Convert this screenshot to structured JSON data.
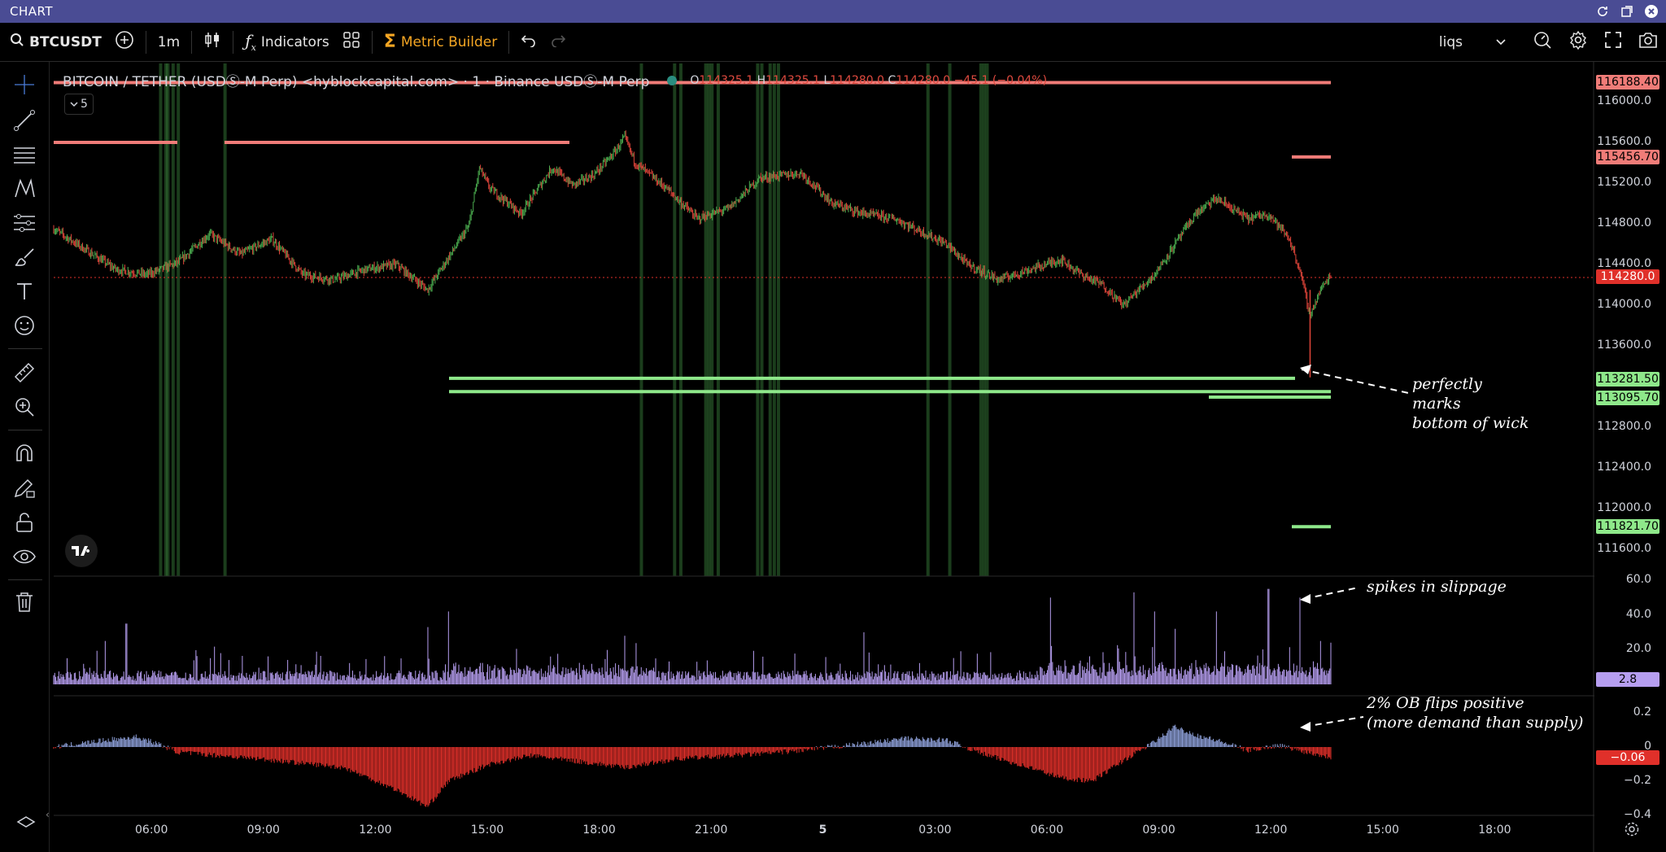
{
  "window": {
    "title": "CHART"
  },
  "toolbar": {
    "symbol": "BTCUSDT",
    "interval": "1m",
    "indicators_label": "Indicators",
    "metric_builder_label": "Metric Builder",
    "layout_select": "liqs"
  },
  "legend": {
    "title": "BITCOIN / TETHER (USDⓈ-M Perp) <hyblockcapital.com> · 1 · Binance USDⓈ-M Perp",
    "o_label": "O",
    "o": "114325.1",
    "h_label": "H",
    "h": "114325.1",
    "l_label": "L",
    "l": "114280.0",
    "c_label": "C",
    "c": "114280.0",
    "change": "−45.1 (−0.04%)",
    "collapsed_count": "5"
  },
  "price_axis": {
    "ticks": [
      "116000.0",
      "115600.0",
      "115200.0",
      "114800.0",
      "114400.0",
      "114000.0",
      "113600.0",
      "112800.0",
      "112400.0",
      "112000.0",
      "111600.0"
    ],
    "labels": [
      {
        "text": "116188.40",
        "bg": "#f07c78",
        "color": "#000"
      },
      {
        "text": "115456.70",
        "bg": "#f07c78",
        "color": "#000"
      },
      {
        "text": "114280.0",
        "bg": "#e0302a",
        "color": "#fff"
      },
      {
        "text": "113281.50",
        "bg": "#8ee88a",
        "color": "#000"
      },
      {
        "text": "113095.70",
        "bg": "#8ee88a",
        "color": "#000"
      },
      {
        "text": "111821.70",
        "bg": "#8ee88a",
        "color": "#000"
      }
    ]
  },
  "slippage_axis": {
    "ticks": [
      "60.0",
      "40.0",
      "20.0"
    ],
    "label": {
      "text": "2.8",
      "bg": "#b69ef0",
      "color": "#000"
    }
  },
  "ob_axis": {
    "ticks": [
      "0.2",
      "0",
      "−0.2",
      "−0.4"
    ],
    "label": {
      "text": "−0.06",
      "bg": "#e0302a",
      "color": "#fff"
    }
  },
  "time_axis": [
    "06:00",
    "09:00",
    "12:00",
    "15:00",
    "18:00",
    "21:00",
    "5",
    "03:00",
    "06:00",
    "09:00",
    "12:00",
    "15:00",
    "18:00"
  ],
  "annotations": {
    "wick": [
      "perfectly",
      "marks",
      "bottom of wick"
    ],
    "slippage": "spikes in slippage",
    "ob": [
      "2% OB flips positive",
      "(more demand than supply)"
    ]
  },
  "colors": {
    "up": "#4caf50",
    "down": "#e0453a",
    "resistance": "#f07c78",
    "support": "#8ee88a",
    "slippage": "#b69ef0",
    "ob_pos": "#8d9fd8",
    "ob_neg": "#e0302a",
    "title_bar": "#4a4c94",
    "accent": "#f5a623"
  },
  "chart_data": [
    {
      "type": "candlestick",
      "title": "BITCOIN / TETHER (USDⓈ-M Perp)",
      "ylim": [
        111400,
        116300
      ],
      "x_ticks": [
        "06:00",
        "09:00",
        "12:00",
        "15:00",
        "18:00",
        "21:00",
        "5",
        "03:00",
        "06:00",
        "09:00",
        "12:00",
        "15:00",
        "18:00"
      ],
      "price_path": [
        [
          0,
          114750
        ],
        [
          3,
          114550
        ],
        [
          6,
          114350
        ],
        [
          9,
          114300
        ],
        [
          12,
          114420
        ],
        [
          15,
          114700
        ],
        [
          18,
          114500
        ],
        [
          21,
          114650
        ],
        [
          24,
          114300
        ],
        [
          27,
          114250
        ],
        [
          30,
          114350
        ],
        [
          33,
          114400
        ],
        [
          36,
          114150
        ],
        [
          40,
          114780
        ],
        [
          41,
          115350
        ],
        [
          42,
          115150
        ],
        [
          45,
          114900
        ],
        [
          48,
          115350
        ],
        [
          50,
          115180
        ],
        [
          52,
          115280
        ],
        [
          54,
          115500
        ],
        [
          55,
          115650
        ],
        [
          56,
          115400
        ],
        [
          59,
          115150
        ],
        [
          62,
          114850
        ],
        [
          65,
          114950
        ],
        [
          68,
          115250
        ],
        [
          72,
          115300
        ],
        [
          75,
          115000
        ],
        [
          78,
          114900
        ],
        [
          81,
          114850
        ],
        [
          84,
          114700
        ],
        [
          86,
          114600
        ],
        [
          88,
          114400
        ],
        [
          91,
          114250
        ],
        [
          94,
          114350
        ],
        [
          97,
          114450
        ],
        [
          99,
          114300
        ],
        [
          101,
          114200
        ],
        [
          103,
          114000
        ],
        [
          104,
          114100
        ],
        [
          106,
          114300
        ],
        [
          108,
          114600
        ],
        [
          110,
          114900
        ],
        [
          112,
          115050
        ],
        [
          115,
          114850
        ],
        [
          117,
          114900
        ],
        [
          119,
          114650
        ],
        [
          120,
          114350
        ],
        [
          121,
          113900
        ],
        [
          122,
          114150
        ],
        [
          123,
          114300
        ]
      ],
      "vertical_zones": [
        10.3,
        10.8,
        11.0,
        11.5,
        12.0,
        16.5,
        56.6,
        59.8,
        60.4,
        62.8,
        63.1,
        63.4,
        64.0,
        67.8,
        68.2,
        69.0,
        69.4,
        69.8,
        84.2,
        86.3,
        89.3,
        89.6,
        89.9
      ]
    },
    {
      "type": "horizontal-levels",
      "levels": [
        {
          "price": 116188.4,
          "color": "resistance",
          "label": "116188.40"
        },
        {
          "price": 115600,
          "color": "resistance",
          "label": ""
        },
        {
          "price": 115456.7,
          "color": "resistance",
          "label": "115456.70"
        },
        {
          "price": 113281.5,
          "color": "support",
          "label": "113281.50"
        },
        {
          "price": 113150,
          "color": "support",
          "label": ""
        },
        {
          "price": 113095.7,
          "color": "support",
          "label": "113095.70"
        },
        {
          "price": 111821.7,
          "color": "support",
          "label": "111821.70"
        }
      ]
    },
    {
      "type": "bar",
      "title": "slippage",
      "ylim": [
        0,
        60
      ],
      "last": 2.8,
      "spikes": [
        [
          5,
          25
        ],
        [
          7,
          35
        ],
        [
          36,
          33
        ],
        [
          38,
          42
        ],
        [
          55,
          28
        ],
        [
          78,
          30
        ],
        [
          96,
          50
        ],
        [
          104,
          53
        ],
        [
          106,
          42
        ],
        [
          108,
          32
        ],
        [
          112,
          42
        ],
        [
          117,
          55
        ],
        [
          120,
          50
        ],
        [
          122,
          25
        ]
      ]
    },
    {
      "type": "bar",
      "title": "2% OB",
      "ylim": [
        -0.4,
        0.2
      ],
      "last": -0.06,
      "profile": [
        [
          0,
          0
        ],
        [
          5,
          0.04
        ],
        [
          8,
          0.06
        ],
        [
          10,
          0.02
        ],
        [
          12,
          -0.03
        ],
        [
          20,
          -0.07
        ],
        [
          28,
          -0.12
        ],
        [
          33,
          -0.25
        ],
        [
          36,
          -0.35
        ],
        [
          38,
          -0.2
        ],
        [
          42,
          -0.1
        ],
        [
          46,
          -0.05
        ],
        [
          50,
          -0.08
        ],
        [
          55,
          -0.12
        ],
        [
          60,
          -0.07
        ],
        [
          68,
          -0.04
        ],
        [
          72,
          -0.02
        ],
        [
          78,
          0.02
        ],
        [
          82,
          0.05
        ],
        [
          86,
          0.04
        ],
        [
          90,
          -0.05
        ],
        [
          94,
          -0.12
        ],
        [
          97,
          -0.18
        ],
        [
          100,
          -0.2
        ],
        [
          103,
          -0.08
        ],
        [
          106,
          0.03
        ],
        [
          108,
          0.12
        ],
        [
          110,
          0.07
        ],
        [
          112,
          0.04
        ],
        [
          115,
          -0.02
        ],
        [
          118,
          0.01
        ],
        [
          120,
          -0.02
        ],
        [
          123,
          -0.06
        ]
      ]
    }
  ]
}
